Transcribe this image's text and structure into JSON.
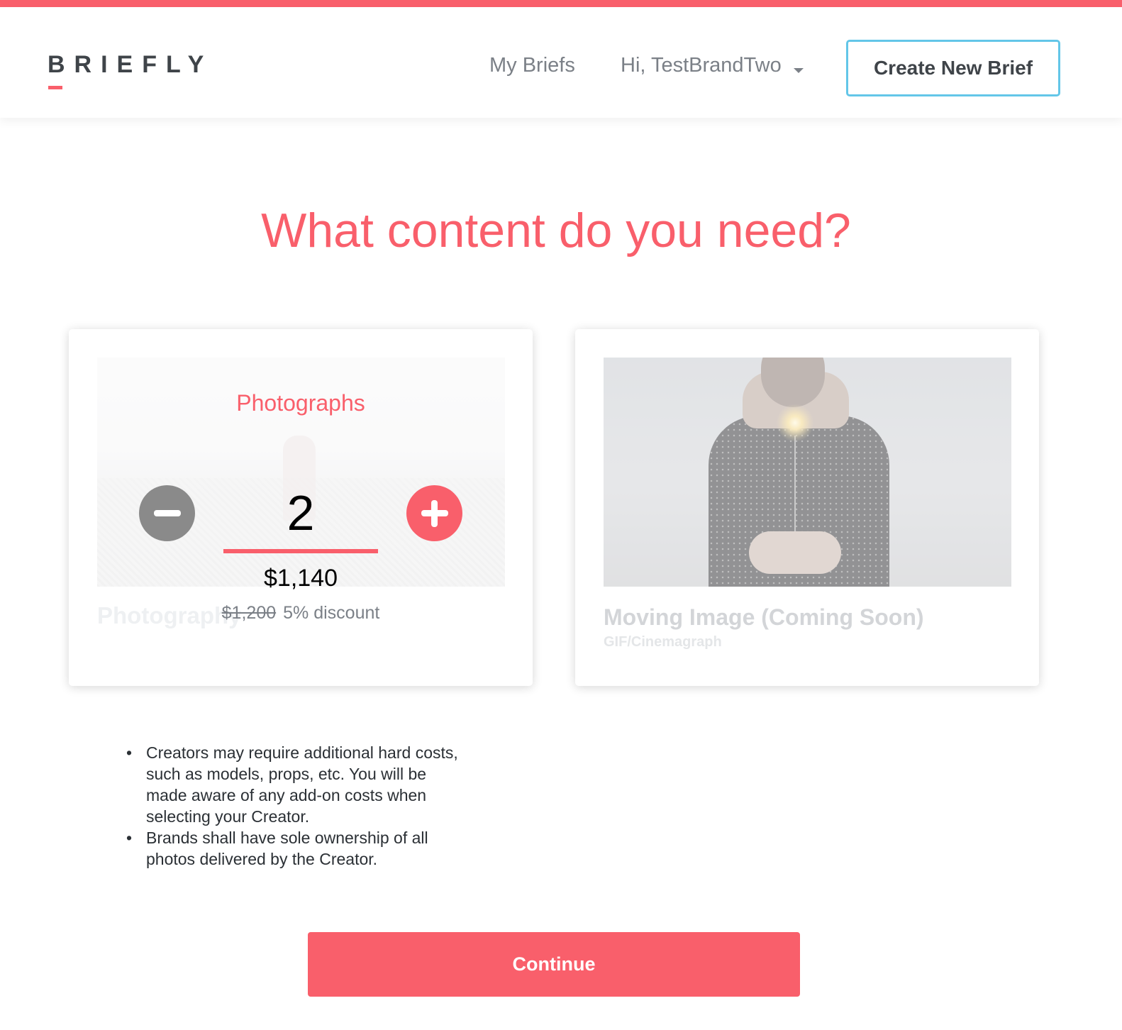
{
  "brand": {
    "logo_text": "BRIEFLY",
    "accent_color": "#f95f6b",
    "outline_color": "#63c6e8"
  },
  "nav": {
    "my_briefs": "My Briefs",
    "user_greeting": "Hi, TestBrandTwo",
    "create_brief": "Create New Brief"
  },
  "page": {
    "title": "What content do you need?"
  },
  "photographs_card": {
    "faded_title": "Photography",
    "label": "Photographs",
    "quantity": "2",
    "price_total": "$1,140",
    "price_original": "$1,200",
    "discount": "5% discount"
  },
  "moving_card": {
    "title": "Moving Image (Coming Soon)",
    "subtitle": "GIF/Cinemagraph"
  },
  "notes": [
    {
      "bullet": "•",
      "text": "Creators may require additional hard costs, such as models, props, etc. You will be made aware of any add-on costs when selecting your Creator."
    },
    {
      "bullet": "•",
      "text": "Brands shall have sole ownership of all photos delivered by the Creator."
    }
  ],
  "actions": {
    "continue": "Continue"
  }
}
